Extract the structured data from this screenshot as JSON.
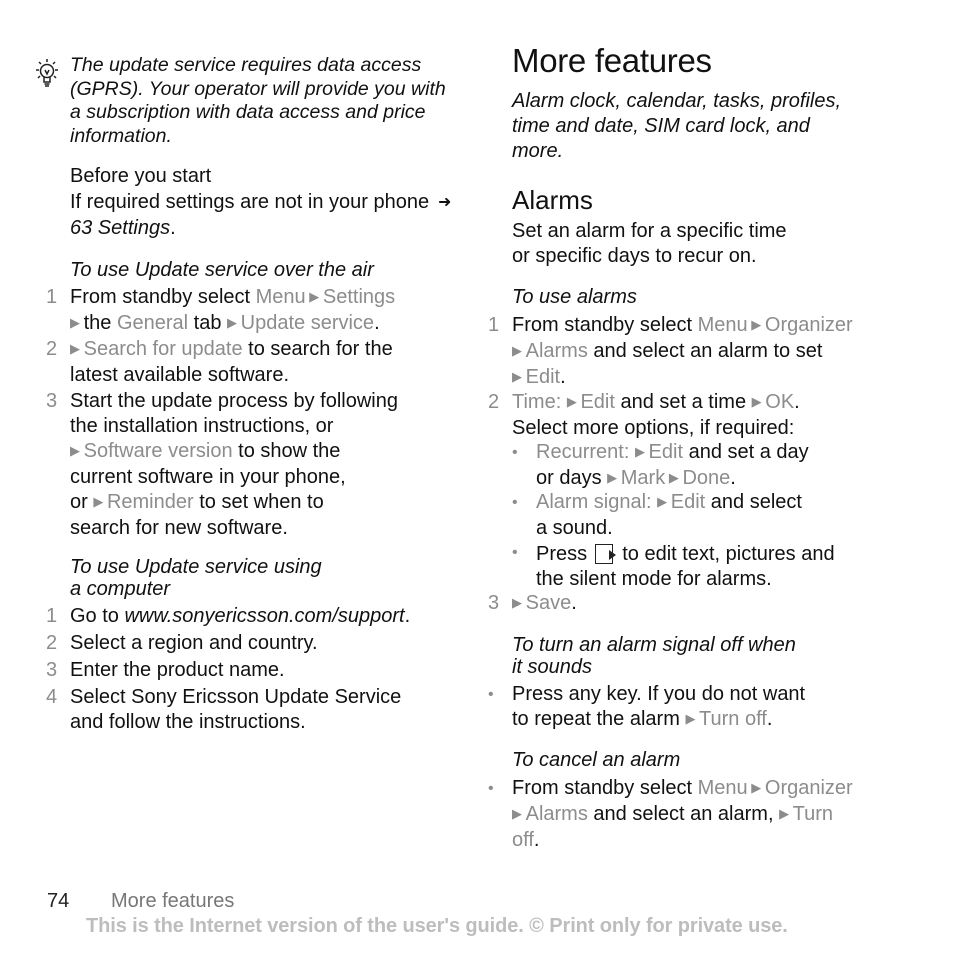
{
  "left": {
    "tip": {
      "icon": "lightbulb-icon",
      "text": "The update service requires data access (GPRS). Your operator will provide you with a subscription with data access and price information."
    },
    "before_start": {
      "heading": "Before you start",
      "text_before": "If required settings are not in your phone",
      "arrow_icon": "arrow-right-icon",
      "ref": "63 Settings",
      "text_after": "."
    },
    "over_air": {
      "heading": "To use Update service over the air",
      "steps": [
        {
          "num": "1",
          "lines": [
            [
              {
                "t": "From standby select "
              },
              {
                "t": "Menu",
                "g": true
              },
              {
                "tri": true
              },
              {
                "t": "Settings",
                "g": true
              }
            ],
            [
              {
                "tri": true
              },
              {
                "t": "the "
              },
              {
                "t": "General",
                "g": true
              },
              {
                "t": " tab "
              },
              {
                "tri": true
              },
              {
                "t": "Update service",
                "g": true
              },
              {
                "t": "."
              }
            ]
          ]
        },
        {
          "num": "2",
          "lines": [
            [
              {
                "tri": true
              },
              {
                "t": "Search for update",
                "g": true
              },
              {
                "t": " to search for the"
              }
            ],
            [
              {
                "t": "latest available software."
              }
            ]
          ]
        },
        {
          "num": "3",
          "lines": [
            [
              {
                "t": "Start the update process by following"
              }
            ],
            [
              {
                "t": "the installation instructions, or"
              }
            ],
            [
              {
                "tri": true
              },
              {
                "t": "Software version",
                "g": true
              },
              {
                "t": " to show the"
              }
            ],
            [
              {
                "t": "current software in your phone,"
              }
            ],
            [
              {
                "t": "or "
              },
              {
                "tri": true
              },
              {
                "t": "Reminder",
                "g": true
              },
              {
                "t": " to set when to"
              }
            ],
            [
              {
                "t": "search for new software."
              }
            ]
          ]
        }
      ]
    },
    "computer": {
      "heading_line1": "To use Update service using",
      "heading_line2": "a computer",
      "steps": [
        {
          "num": "1",
          "lines": [
            [
              {
                "t": "Go to "
              },
              {
                "t": "www.sonyericsson.com/support",
                "i": true
              },
              {
                "t": "."
              }
            ]
          ]
        },
        {
          "num": "2",
          "lines": [
            [
              {
                "t": "Select a region and country."
              }
            ]
          ]
        },
        {
          "num": "3",
          "lines": [
            [
              {
                "t": "Enter the product name."
              }
            ]
          ]
        },
        {
          "num": "4",
          "lines": [
            [
              {
                "t": "Select Sony Ericsson Update Service"
              }
            ],
            [
              {
                "t": "and follow the instructions."
              }
            ]
          ]
        }
      ]
    }
  },
  "right": {
    "page_title": "More features",
    "intro_lines": [
      "Alarm clock, calendar, tasks, profiles,",
      "time and date, SIM card lock, and",
      "more."
    ],
    "section_title": "Alarms",
    "section_text_lines": [
      "Set an alarm for a specific time",
      "or specific days to recur on."
    ],
    "use_alarms": {
      "heading": "To use alarms",
      "steps": [
        {
          "num": "1",
          "lines": [
            [
              {
                "t": "From standby select "
              },
              {
                "t": "Menu",
                "g": true
              },
              {
                "tri": true
              },
              {
                "t": "Organizer",
                "g": true
              }
            ],
            [
              {
                "tri": true
              },
              {
                "t": "Alarms",
                "g": true
              },
              {
                "t": " and select an alarm to set"
              }
            ],
            [
              {
                "tri": true
              },
              {
                "t": "Edit",
                "g": true
              },
              {
                "t": "."
              }
            ]
          ]
        },
        {
          "num": "2",
          "lines": [
            [
              {
                "t": "Time: ",
                "g": true
              },
              {
                "tri": true
              },
              {
                "t": "Edit",
                "g": true
              },
              {
                "t": " and set a time "
              },
              {
                "tri": true
              },
              {
                "t": "OK",
                "g": true
              },
              {
                "t": "."
              }
            ],
            [
              {
                "t": "Select more options, if required:"
              }
            ]
          ]
        }
      ],
      "sub_bullets": [
        {
          "lines": [
            [
              {
                "t": "Recurrent: ",
                "g": true
              },
              {
                "tri": true
              },
              {
                "t": "Edit",
                "g": true
              },
              {
                "t": " and set a day"
              }
            ],
            [
              {
                "t": "or days "
              },
              {
                "tri": true
              },
              {
                "t": "Mark",
                "g": true
              },
              {
                "tri": true
              },
              {
                "t": "Done",
                "g": true
              },
              {
                "t": "."
              }
            ]
          ]
        },
        {
          "lines": [
            [
              {
                "t": "Alarm signal: ",
                "g": true
              },
              {
                "tri": true
              },
              {
                "t": "Edit",
                "g": true
              },
              {
                "t": " and select"
              }
            ],
            [
              {
                "t": "a sound."
              }
            ]
          ]
        },
        {
          "lines": [
            [
              {
                "t": "Press "
              },
              {
                "key": true
              },
              {
                "t": " to edit text, pictures and"
              }
            ],
            [
              {
                "t": "the silent mode for alarms."
              }
            ]
          ]
        }
      ],
      "step3": {
        "num": "3",
        "lines": [
          [
            {
              "tri": true
            },
            {
              "t": "Save",
              "g": true
            },
            {
              "t": "."
            }
          ]
        ]
      }
    },
    "turn_off": {
      "heading_line1": "To turn an alarm signal off when",
      "heading_line2": "it sounds",
      "bullet": {
        "lines": [
          [
            {
              "t": "Press any key. If you do not want"
            }
          ],
          [
            {
              "t": "to repeat the alarm "
            },
            {
              "tri": true
            },
            {
              "t": "Turn off",
              "g": true
            },
            {
              "t": "."
            }
          ]
        ]
      }
    },
    "cancel": {
      "heading": "To cancel an alarm",
      "bullet": {
        "lines": [
          [
            {
              "t": "From standby select "
            },
            {
              "t": "Menu",
              "g": true
            },
            {
              "tri": true
            },
            {
              "t": "Organizer",
              "g": true
            }
          ],
          [
            {
              "tri": true
            },
            {
              "t": "Alarms",
              "g": true
            },
            {
              "t": " and select an alarm, "
            },
            {
              "tri": true
            },
            {
              "t": "Turn",
              "g": true
            }
          ],
          [
            {
              "t": "off",
              "g": true
            },
            {
              "t": "."
            }
          ]
        ]
      }
    }
  },
  "footer": {
    "page_number": "74",
    "section": "More features",
    "note": "This is the Internet version of the user's guide. © Print only for private use."
  },
  "colors": {
    "text": "#111111",
    "menu_gray": "#8c8c8c",
    "footer_note": "#bdbdbd"
  }
}
